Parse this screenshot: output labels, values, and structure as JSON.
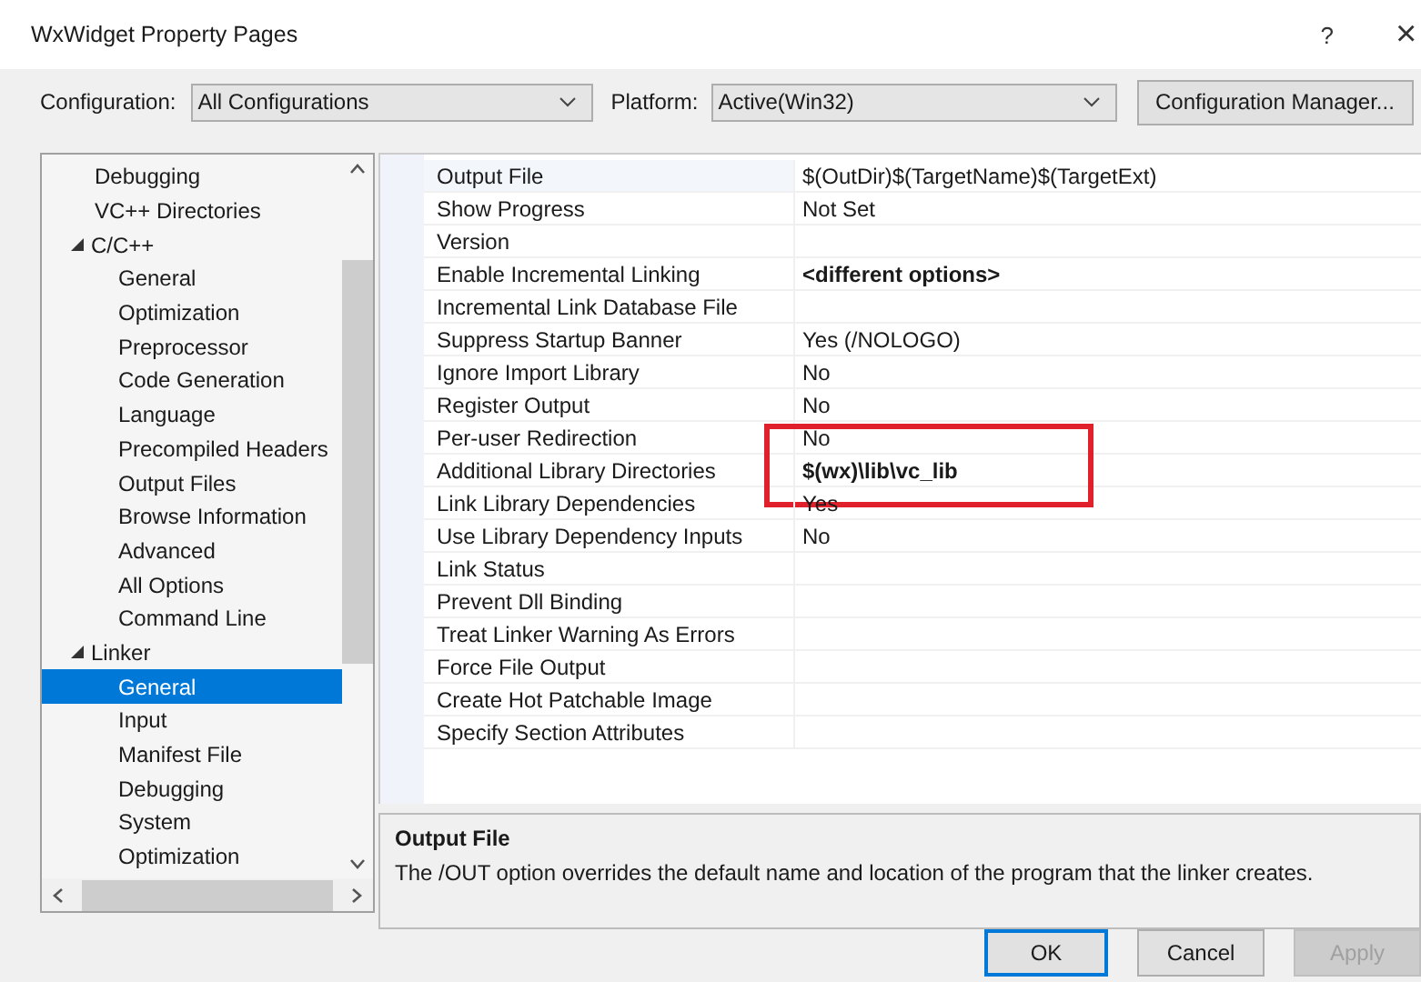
{
  "window": {
    "title": "WxWidget Property Pages",
    "help": "?",
    "close": "×"
  },
  "toolbar": {
    "configuration_label": "Configuration:",
    "configuration": "All Configurations",
    "platform_label": "Platform:",
    "platform": "Active(Win32)",
    "manager_button": "Configuration Manager..."
  },
  "tree": [
    {
      "label": "Debugging",
      "selected": false
    },
    {
      "label": "VC++ Directories",
      "selected": false
    },
    {
      "label": "C/C++",
      "selected": false,
      "expanded": true,
      "children": [
        {
          "label": "General",
          "selected": false
        },
        {
          "label": "Optimization",
          "selected": false
        },
        {
          "label": "Preprocessor",
          "selected": false
        },
        {
          "label": "Code Generation",
          "selected": false
        },
        {
          "label": "Language",
          "selected": false
        },
        {
          "label": "Precompiled Headers",
          "selected": false
        },
        {
          "label": "Output Files",
          "selected": false
        },
        {
          "label": "Browse Information",
          "selected": false
        },
        {
          "label": "Advanced",
          "selected": false
        },
        {
          "label": "All Options",
          "selected": false
        },
        {
          "label": "Command Line",
          "selected": false
        }
      ]
    },
    {
      "label": "Linker",
      "selected": false,
      "expanded": true,
      "children": [
        {
          "label": "General",
          "selected": true
        },
        {
          "label": "Input",
          "selected": false
        },
        {
          "label": "Manifest File",
          "selected": false
        },
        {
          "label": "Debugging",
          "selected": false
        },
        {
          "label": "System",
          "selected": false
        },
        {
          "label": "Optimization",
          "selected": false
        }
      ]
    }
  ],
  "properties": [
    {
      "name": "Output File",
      "value": "$(OutDir)$(TargetName)$(TargetExt)",
      "bold": false,
      "selected": true,
      "marked": false
    },
    {
      "name": "Show Progress",
      "value": "Not Set",
      "bold": false,
      "selected": false,
      "marked": false
    },
    {
      "name": "Version",
      "selected": false,
      "marked": false
    },
    {
      "name": "Enable Incremental Linking",
      "value": "<different options>",
      "bold": true,
      "selected": false,
      "marked": false
    },
    {
      "name": "Incremental Link Database File",
      "selected": false,
      "marked": false
    },
    {
      "name": "Suppress Startup Banner",
      "value": "Yes (/NOLOGO)",
      "bold": false,
      "selected": false,
      "marked": false
    },
    {
      "name": "Ignore Import Library",
      "value": "No",
      "bold": false,
      "selected": false,
      "marked": false
    },
    {
      "name": "Register Output",
      "value": "No",
      "bold": false,
      "selected": false,
      "marked": false
    },
    {
      "name": "Per-user Redirection",
      "value": "No",
      "bold": false,
      "selected": false,
      "marked": false
    },
    {
      "name": "Additional Library Directories",
      "value": "$(wx)\\lib\\vc_lib",
      "bold": true,
      "selected": false,
      "marked": true
    },
    {
      "name": "Link Library Dependencies",
      "value": "Yes",
      "bold": false,
      "selected": false,
      "marked": false
    },
    {
      "name": "Use Library Dependency Inputs",
      "value": "No",
      "bold": false,
      "selected": false,
      "marked": false
    },
    {
      "name": "Link Status",
      "selected": false,
      "marked": false
    },
    {
      "name": "Prevent Dll Binding",
      "selected": false,
      "marked": false
    },
    {
      "name": "Treat Linker Warning As Errors",
      "selected": false,
      "marked": false
    },
    {
      "name": "Force File Output",
      "selected": false,
      "marked": false
    },
    {
      "name": "Create Hot Patchable Image",
      "selected": false,
      "marked": false
    },
    {
      "name": "Specify Section Attributes",
      "selected": false,
      "marked": false
    }
  ],
  "description": {
    "title": "Output File",
    "text": "The /OUT option overrides the default name and location of the program that the linker creates."
  },
  "buttons": [
    {
      "label": "OK",
      "disabled": false,
      "default": true
    },
    {
      "label": "Cancel",
      "disabled": false,
      "default": false
    },
    {
      "label": "Apply",
      "disabled": true,
      "default": false
    }
  ]
}
